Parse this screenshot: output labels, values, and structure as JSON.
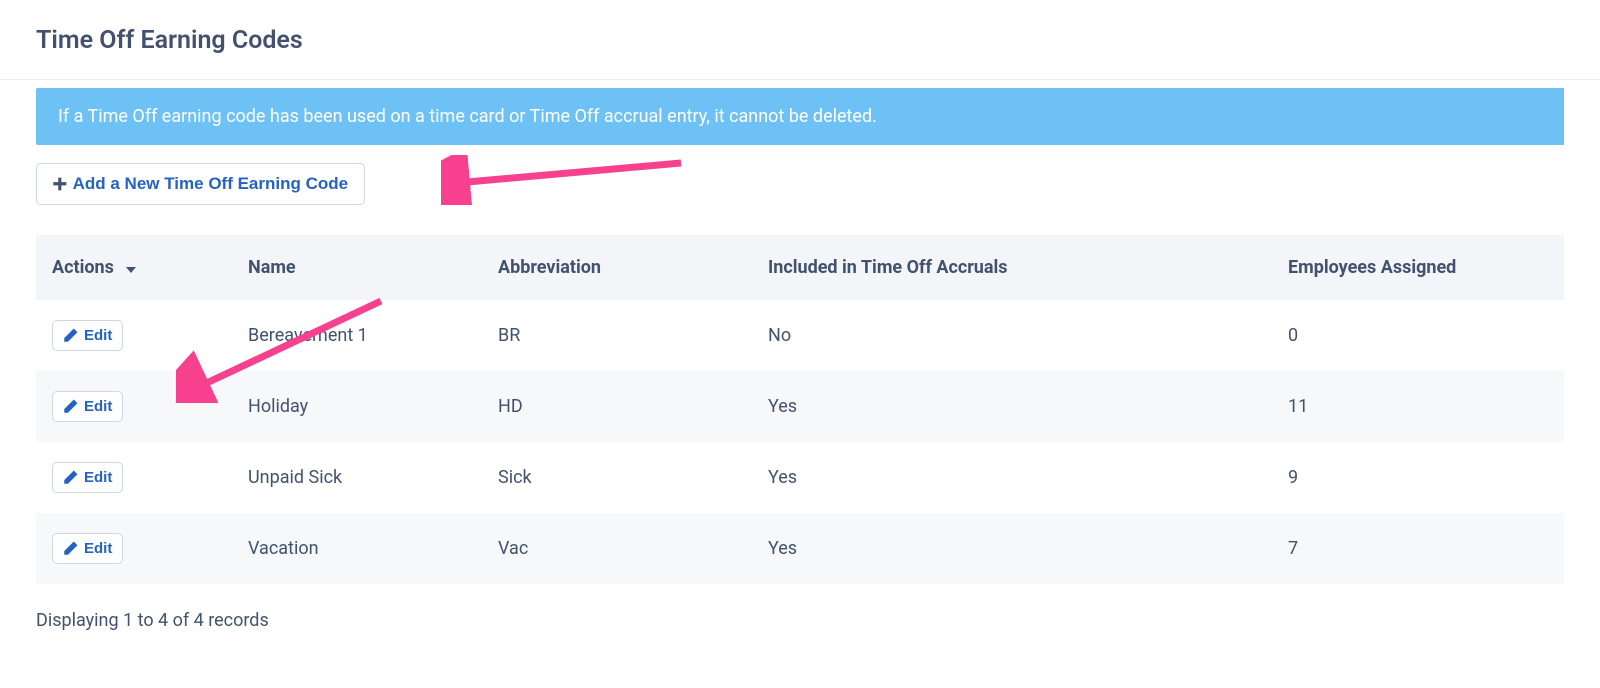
{
  "header": {
    "title": "Time Off Earning Codes"
  },
  "banner": {
    "text": "If a Time Off earning code has been used on a time card or Time Off accrual entry, it cannot be deleted."
  },
  "toolbar": {
    "add_label": "Add a New Time Off Earning Code"
  },
  "table": {
    "columns": {
      "actions": "Actions",
      "name": "Name",
      "abbreviation": "Abbreviation",
      "accruals": "Included in Time Off Accruals",
      "employees": "Employees Assigned"
    },
    "edit_label": "Edit",
    "rows": [
      {
        "name": "Bereavement 1",
        "abbreviation": "BR",
        "accruals": "No",
        "employees": "0"
      },
      {
        "name": "Holiday",
        "abbreviation": "HD",
        "accruals": "Yes",
        "employees": "11"
      },
      {
        "name": "Unpaid Sick",
        "abbreviation": "Sick",
        "accruals": "Yes",
        "employees": "9"
      },
      {
        "name": "Vacation",
        "abbreviation": "Vac",
        "accruals": "Yes",
        "employees": "7"
      }
    ]
  },
  "footer": {
    "text": "Displaying 1 to 4 of 4 records"
  },
  "colors": {
    "accent": "#2563c2",
    "banner_bg": "#6ec1f5",
    "annotation": "#f7418f"
  }
}
